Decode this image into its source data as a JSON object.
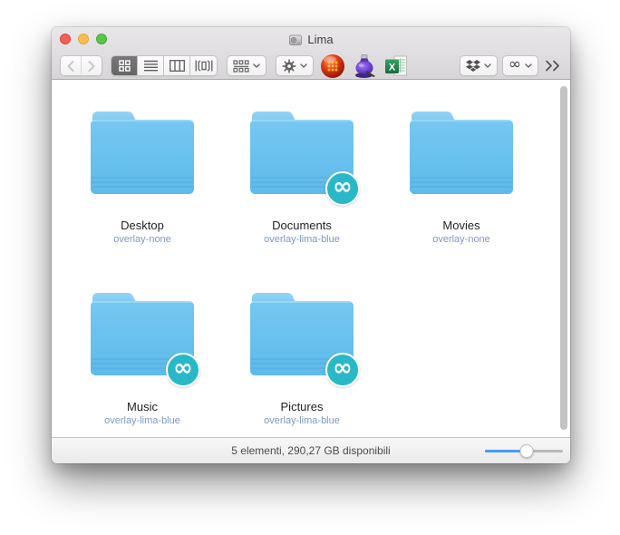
{
  "window": {
    "title": "Lima"
  },
  "toolbar": {
    "views": [
      "icon-view",
      "list-view",
      "column-view",
      "coverflow-view"
    ],
    "overflow_label": "»",
    "infinity_label": "∞",
    "app_icons": [
      "red-sphere-app",
      "purple-ink-app",
      "excel-app"
    ]
  },
  "files": {
    "badge_glyph": "∞",
    "items": [
      {
        "name": "Desktop",
        "overlay": "overlay-none",
        "badged": false
      },
      {
        "name": "Documents",
        "overlay": "overlay-lima-blue",
        "badged": true
      },
      {
        "name": "Movies",
        "overlay": "overlay-none",
        "badged": false
      },
      {
        "name": "Music",
        "overlay": "overlay-lima-blue",
        "badged": true
      },
      {
        "name": "Pictures",
        "overlay": "overlay-lima-blue",
        "badged": true
      }
    ]
  },
  "status": {
    "text": "5 elementi, 290,27 GB disponibili",
    "slider_percent": 53
  },
  "colors": {
    "folder_blue": "#6CC4F0",
    "folder_tab_blue": "#8BCFF3",
    "badge_teal": "#29B8C8",
    "overlay_label_blue": "#7E98C4",
    "slider_blue": "#4A9BF5",
    "traffic_red": "#F25F57",
    "traffic_yellow": "#F6BE4F",
    "traffic_green": "#55C843"
  }
}
